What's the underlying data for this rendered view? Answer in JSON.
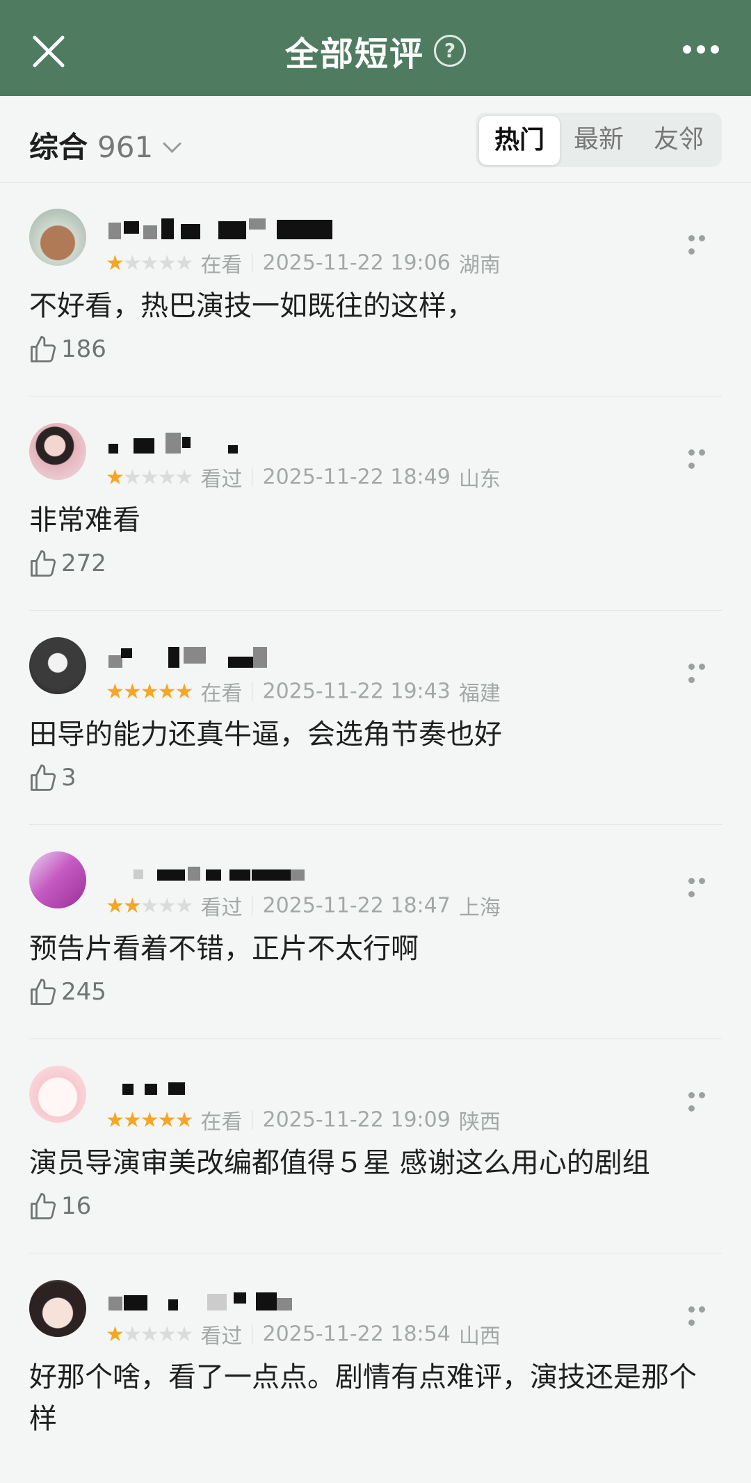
{
  "header": {
    "title": "全部短评",
    "help_icon": "question-circle-icon",
    "close_icon": "close-icon",
    "more_icon": "more-horizontal-icon"
  },
  "filter": {
    "sort_label": "综合",
    "count": "961",
    "tabs": [
      {
        "label": "热门",
        "active": true
      },
      {
        "label": "最新",
        "active": false
      },
      {
        "label": "友邻",
        "active": false
      }
    ]
  },
  "colors": {
    "header_bg": "#4f7b61",
    "star": "#f5a623",
    "star_off": "#dadcdc"
  },
  "reviews": [
    {
      "rating": 1,
      "status": "在看",
      "datetime": "2025-11-22 19:06",
      "region": "湖南",
      "content": "不好看，热巴演技一如既往的这样，",
      "likes": "186"
    },
    {
      "rating": 1,
      "status": "看过",
      "datetime": "2025-11-22 18:49",
      "region": "山东",
      "content": "非常难看",
      "likes": "272"
    },
    {
      "rating": 5,
      "status": "在看",
      "datetime": "2025-11-22 19:43",
      "region": "福建",
      "content": "田导的能力还真牛逼，会选角节奏也好",
      "likes": "3"
    },
    {
      "rating": 2,
      "status": "看过",
      "datetime": "2025-11-22 18:47",
      "region": "上海",
      "content": "预告片看着不错，正片不太行啊",
      "likes": "245"
    },
    {
      "rating": 5,
      "status": "在看",
      "datetime": "2025-11-22 19:09",
      "region": "陕西",
      "content": "演员导演审美改编都值得５星 感谢这么用心的剧组",
      "likes": "16"
    },
    {
      "rating": 1,
      "status": "看过",
      "datetime": "2025-11-22 18:54",
      "region": "山西",
      "content": "好那个啥，看了一点点。剧情有点难评，演技还是那个样",
      "likes": ""
    }
  ]
}
